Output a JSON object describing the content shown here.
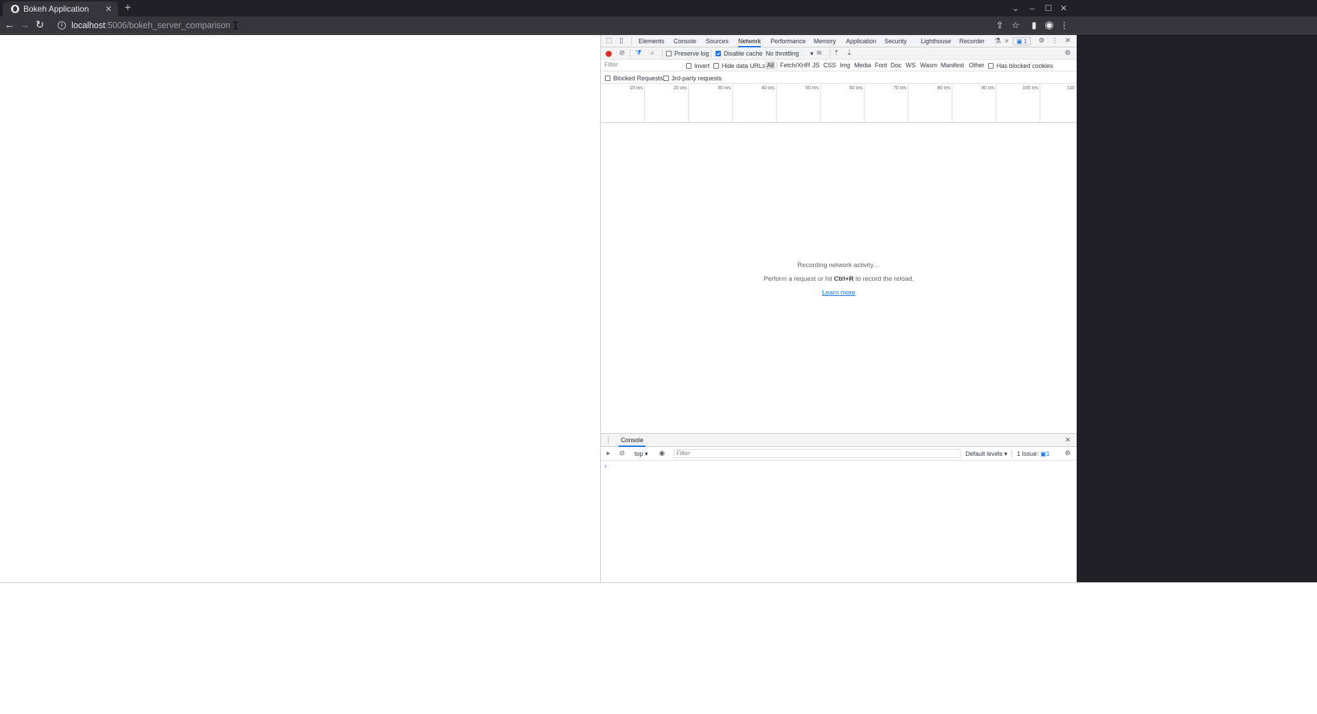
{
  "browser": {
    "tab_title": "Bokeh Application",
    "url_host": "localhost",
    "url_rest": ":5006/bokeh_server_comparison"
  },
  "devtools": {
    "tabs": [
      "Elements",
      "Console",
      "Sources",
      "Network",
      "Performance",
      "Memory",
      "Application",
      "Security",
      "Lighthouse",
      "Recorder"
    ],
    "active_tab": "Network",
    "issue_count": "1",
    "network": {
      "preserve_log": "Preserve log",
      "disable_cache": "Disable cache",
      "throttling": "No throttling",
      "filter_placeholder": "Filter",
      "invert": "Invert",
      "hide_data_urls": "Hide data URLs",
      "types": [
        "All",
        "Fetch/XHR",
        "JS",
        "CSS",
        "Img",
        "Media",
        "Font",
        "Doc",
        "WS",
        "Wasm",
        "Manifest",
        "Other"
      ],
      "has_blocked_cookies": "Has blocked cookies",
      "blocked_requests": "Blocked Requests",
      "third_party": "3rd-party requests",
      "timeline_ticks": [
        "10 ms",
        "20 ms",
        "30 ms",
        "40 ms",
        "50 ms",
        "60 ms",
        "70 ms",
        "80 ms",
        "90 ms",
        "100 ms",
        "110"
      ],
      "empty_line1": "Recording network activity…",
      "empty_line2_pre": "Perform a request or hit ",
      "empty_line2_key": "Ctrl+R",
      "empty_line2_post": " to record the reload.",
      "learn_more": "Learn more"
    },
    "console": {
      "tab_label": "Console",
      "context": "top ▾",
      "filter_placeholder": "Filter",
      "levels": "Default levels ▾",
      "issues_label": "1 Issue:",
      "issues_count": "1",
      "prompt": "›"
    }
  },
  "colors": {
    "accent": "#1a73e8",
    "record": "#d93025",
    "chrome_dark": "#202124"
  },
  "icons": [
    "back-icon",
    "forward-icon",
    "reload-icon",
    "info-icon",
    "share-icon",
    "star-icon",
    "side-panel-icon",
    "profile-icon",
    "menu-icon"
  ]
}
